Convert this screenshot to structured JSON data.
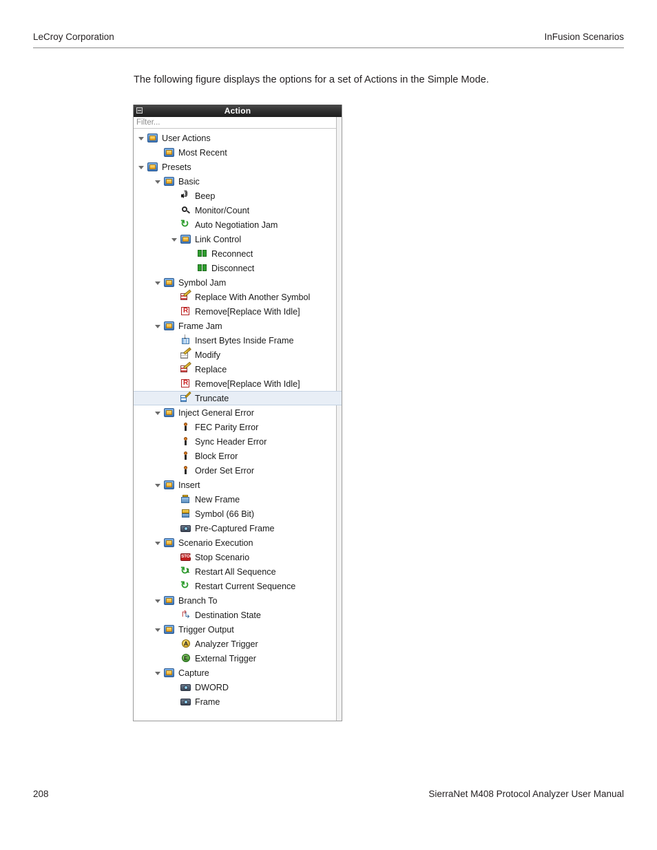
{
  "header": {
    "left": "LeCroy Corporation",
    "right": "InFusion Scenarios"
  },
  "body": {
    "paragraph": "The following figure displays the options for a set of Actions in the Simple Mode."
  },
  "panel": {
    "title": "Action",
    "collapse_icon": "minus-box-icon",
    "filter_placeholder": "Filter...",
    "selected_item": "Truncate",
    "tree": [
      {
        "label": "User Actions",
        "indent": 0,
        "icon": "group-icon",
        "twisty": "open",
        "selected": false
      },
      {
        "label": "Most Recent",
        "indent": 1,
        "icon": "group-icon",
        "twisty": "none",
        "selected": false
      },
      {
        "label": "Presets",
        "indent": 0,
        "icon": "group-icon",
        "twisty": "open",
        "selected": false
      },
      {
        "label": "Basic",
        "indent": 1,
        "icon": "group-icon",
        "twisty": "open",
        "selected": false
      },
      {
        "label": "Beep",
        "indent": 2,
        "icon": "beep-icon",
        "twisty": "none",
        "selected": false
      },
      {
        "label": "Monitor/Count",
        "indent": 2,
        "icon": "monitor-count-icon",
        "twisty": "none",
        "selected": false
      },
      {
        "label": "Auto Negotiation Jam",
        "indent": 2,
        "icon": "refresh-icon",
        "twisty": "none",
        "selected": false
      },
      {
        "label": "Link Control",
        "indent": 2,
        "icon": "group-icon",
        "twisty": "open",
        "selected": false
      },
      {
        "label": "Reconnect",
        "indent": 3,
        "icon": "link-plug-icon",
        "twisty": "none",
        "selected": false
      },
      {
        "label": "Disconnect",
        "indent": 3,
        "icon": "link-plug-icon",
        "twisty": "none",
        "selected": false
      },
      {
        "label": "Symbol Jam",
        "indent": 1,
        "icon": "group-icon",
        "twisty": "open",
        "selected": false
      },
      {
        "label": "Replace With Another Symbol",
        "indent": 2,
        "icon": "replace-icon",
        "twisty": "none",
        "selected": false
      },
      {
        "label": "Remove[Replace With Idle]",
        "indent": 2,
        "icon": "remove-icon",
        "twisty": "none",
        "selected": false
      },
      {
        "label": "Frame Jam",
        "indent": 1,
        "icon": "group-icon",
        "twisty": "open",
        "selected": false
      },
      {
        "label": "Insert Bytes Inside Frame",
        "indent": 2,
        "icon": "insert-bytes-icon",
        "twisty": "none",
        "selected": false
      },
      {
        "label": "Modify",
        "indent": 2,
        "icon": "modify-icon",
        "twisty": "none",
        "selected": false
      },
      {
        "label": "Replace",
        "indent": 2,
        "icon": "replace-icon",
        "twisty": "none",
        "selected": false
      },
      {
        "label": "Remove[Replace With Idle]",
        "indent": 2,
        "icon": "remove-icon",
        "twisty": "none",
        "selected": false
      },
      {
        "label": "Truncate",
        "indent": 2,
        "icon": "truncate-icon",
        "twisty": "none",
        "selected": true
      },
      {
        "label": "Inject General Error",
        "indent": 1,
        "icon": "group-icon",
        "twisty": "open",
        "selected": false
      },
      {
        "label": "FEC Parity Error",
        "indent": 2,
        "icon": "error-icon",
        "twisty": "none",
        "selected": false
      },
      {
        "label": "Sync Header Error",
        "indent": 2,
        "icon": "error-icon",
        "twisty": "none",
        "selected": false
      },
      {
        "label": "Block Error",
        "indent": 2,
        "icon": "error-icon",
        "twisty": "none",
        "selected": false
      },
      {
        "label": "Order Set Error",
        "indent": 2,
        "icon": "error-icon",
        "twisty": "none",
        "selected": false
      },
      {
        "label": "Insert",
        "indent": 1,
        "icon": "group-icon",
        "twisty": "open",
        "selected": false
      },
      {
        "label": "New Frame",
        "indent": 2,
        "icon": "new-frame-icon",
        "twisty": "none",
        "selected": false
      },
      {
        "label": "Symbol (66 Bit)",
        "indent": 2,
        "icon": "symbol-icon",
        "twisty": "none",
        "selected": false
      },
      {
        "label": "Pre-Captured Frame",
        "indent": 2,
        "icon": "camera-icon",
        "twisty": "none",
        "selected": false
      },
      {
        "label": "Scenario Execution",
        "indent": 1,
        "icon": "group-icon",
        "twisty": "open",
        "selected": false
      },
      {
        "label": "Stop Scenario",
        "indent": 2,
        "icon": "stop-icon",
        "twisty": "none",
        "selected": false
      },
      {
        "label": "Restart All Sequence",
        "indent": 2,
        "icon": "refresh-num-icon",
        "twisty": "none",
        "selected": false
      },
      {
        "label": "Restart Current Sequence",
        "indent": 2,
        "icon": "refresh-icon",
        "twisty": "none",
        "selected": false
      },
      {
        "label": "Branch To",
        "indent": 1,
        "icon": "group-icon",
        "twisty": "open",
        "selected": false
      },
      {
        "label": "Destination State",
        "indent": 2,
        "icon": "branch-icon",
        "twisty": "none",
        "selected": false
      },
      {
        "label": "Trigger Output",
        "indent": 1,
        "icon": "group-icon",
        "twisty": "open",
        "selected": false
      },
      {
        "label": "Analyzer Trigger",
        "indent": 2,
        "icon": "analyzer-trigger-icon",
        "twisty": "none",
        "selected": false
      },
      {
        "label": "External Trigger",
        "indent": 2,
        "icon": "external-trigger-icon",
        "twisty": "none",
        "selected": false
      },
      {
        "label": "Capture",
        "indent": 1,
        "icon": "group-icon",
        "twisty": "open",
        "selected": false
      },
      {
        "label": "DWORD",
        "indent": 2,
        "icon": "camera-icon",
        "twisty": "none",
        "selected": false
      },
      {
        "label": "Frame",
        "indent": 2,
        "icon": "camera-icon",
        "twisty": "none",
        "selected": false
      }
    ]
  },
  "footer": {
    "page_number": "208",
    "manual_title": "SierraNet M408 Protocol Analyzer User Manual"
  },
  "colors": {
    "text": "#231f20",
    "selection": "#e8eef6",
    "titlebar": "#2b2b2b"
  }
}
